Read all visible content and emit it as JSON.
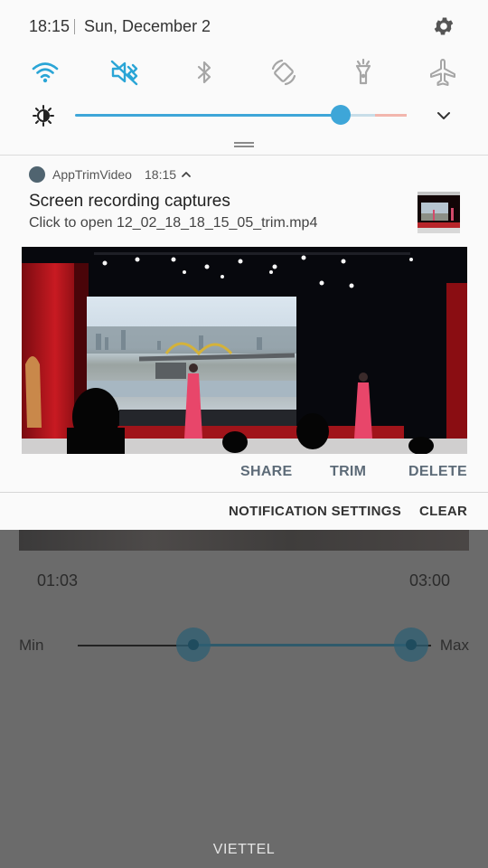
{
  "status_bar": {
    "time": "18:15",
    "date": "Sun, December 2"
  },
  "quick_settings": {
    "tiles": [
      {
        "name": "wifi-icon",
        "active": true
      },
      {
        "name": "sound-mute-icon",
        "active": true
      },
      {
        "name": "bluetooth-icon",
        "active": false
      },
      {
        "name": "auto-rotate-icon",
        "active": false
      },
      {
        "name": "flashlight-icon",
        "active": false
      },
      {
        "name": "airplane-mode-icon",
        "active": false
      }
    ],
    "active_color": "#2aa5d6",
    "inactive_color": "#a6a6a6"
  },
  "brightness": {
    "level_percent": 80,
    "accent": "#3ea6d8"
  },
  "notification": {
    "app_name": "AppTrimVideo",
    "time": "18:15",
    "title": "Screen recording captures",
    "text": "Click to open 12_02_18_18_15_05_trim.mp4",
    "actions": {
      "share": "SHARE",
      "trim": "TRIM",
      "delete": "DELETE"
    }
  },
  "shade_footer": {
    "settings": "NOTIFICATION SETTINGS",
    "clear": "CLEAR"
  },
  "background_app": {
    "start_time": "01:03",
    "end_time": "03:00",
    "min_label": "Min",
    "max_label": "Max",
    "range_start_fraction": 0.33,
    "range_end_fraction": 0.95,
    "carrier": "VIETTEL"
  }
}
